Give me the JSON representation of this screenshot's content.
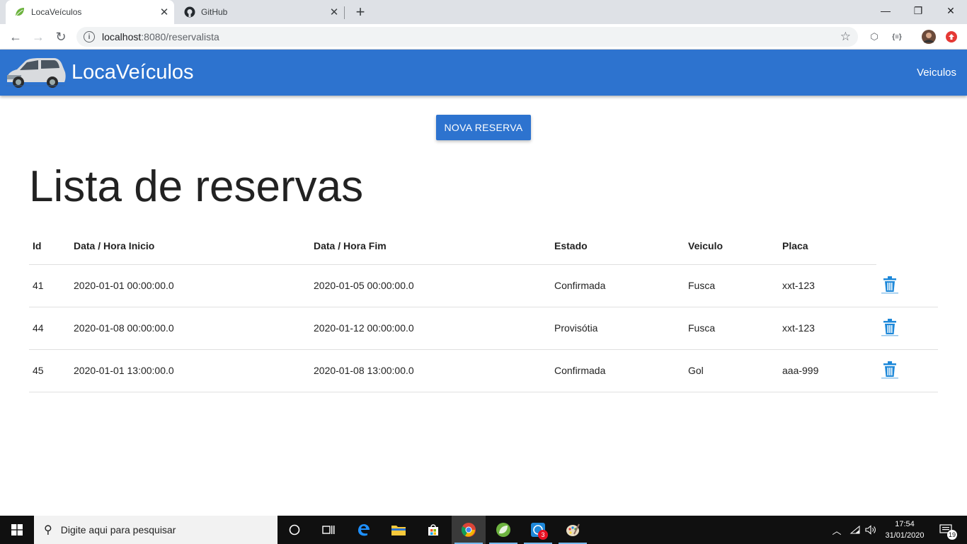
{
  "browser": {
    "tabs": [
      {
        "title": "LocaVeículos"
      },
      {
        "title": "GitHub"
      }
    ],
    "url_host": "localhost",
    "url_path": ":8080/reservalista"
  },
  "app": {
    "brand": "LocaVeículos",
    "nav_link": "Veiculos",
    "new_button": "NOVA RESERVA",
    "page_title": "Lista de reservas",
    "table": {
      "headers": [
        "Id",
        "Data / Hora Inicio",
        "Data / Hora Fim",
        "Estado",
        "Veiculo",
        "Placa"
      ],
      "rows": [
        [
          "41",
          "2020-01-01 00:00:00.0",
          "2020-01-05 00:00:00.0",
          "Confirmada",
          "Fusca",
          "xxt-123"
        ],
        [
          "44",
          "2020-01-08 00:00:00.0",
          "2020-01-12 00:00:00.0",
          "Provisótia",
          "Fusca",
          "xxt-123"
        ],
        [
          "45",
          "2020-01-01 13:00:00.0",
          "2020-01-08 13:00:00.0",
          "Confirmada",
          "Gol",
          "aaa-999"
        ]
      ]
    },
    "colors": {
      "primary": "#2d73cf",
      "trash_icon": "#1e88d9"
    }
  },
  "taskbar": {
    "search_placeholder": "Digite aqui para pesquisar",
    "time": "17:54",
    "date": "31/01/2020",
    "notification_count": "19",
    "app_badge": "3"
  }
}
